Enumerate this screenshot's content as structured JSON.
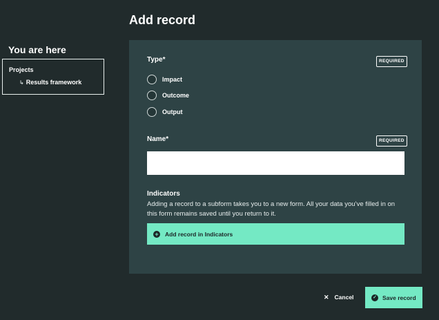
{
  "header": {
    "title": "Add record"
  },
  "breadcrumb": {
    "heading": "You are here",
    "root": "Projects",
    "child": "Results framework"
  },
  "form": {
    "type": {
      "label": "Type*",
      "required_badge": "REQUIRED",
      "options": [
        "Impact",
        "Outcome",
        "Output"
      ]
    },
    "name": {
      "label": "Name*",
      "required_badge": "REQUIRED",
      "value": ""
    },
    "indicators": {
      "label": "Indicators",
      "help": "Adding a record to a subform takes you to a new form. All your data you’ve filled in on this form remains saved until you return to it.",
      "add_button": "Add record in Indicators"
    }
  },
  "actions": {
    "cancel": "Cancel",
    "save": "Save record"
  },
  "colors": {
    "background": "#212b2c",
    "panel": "#2e4345",
    "accent": "#74e9c4"
  },
  "icons": [
    "return-arrow-icon",
    "plus-icon",
    "close-icon",
    "check-icon"
  ]
}
